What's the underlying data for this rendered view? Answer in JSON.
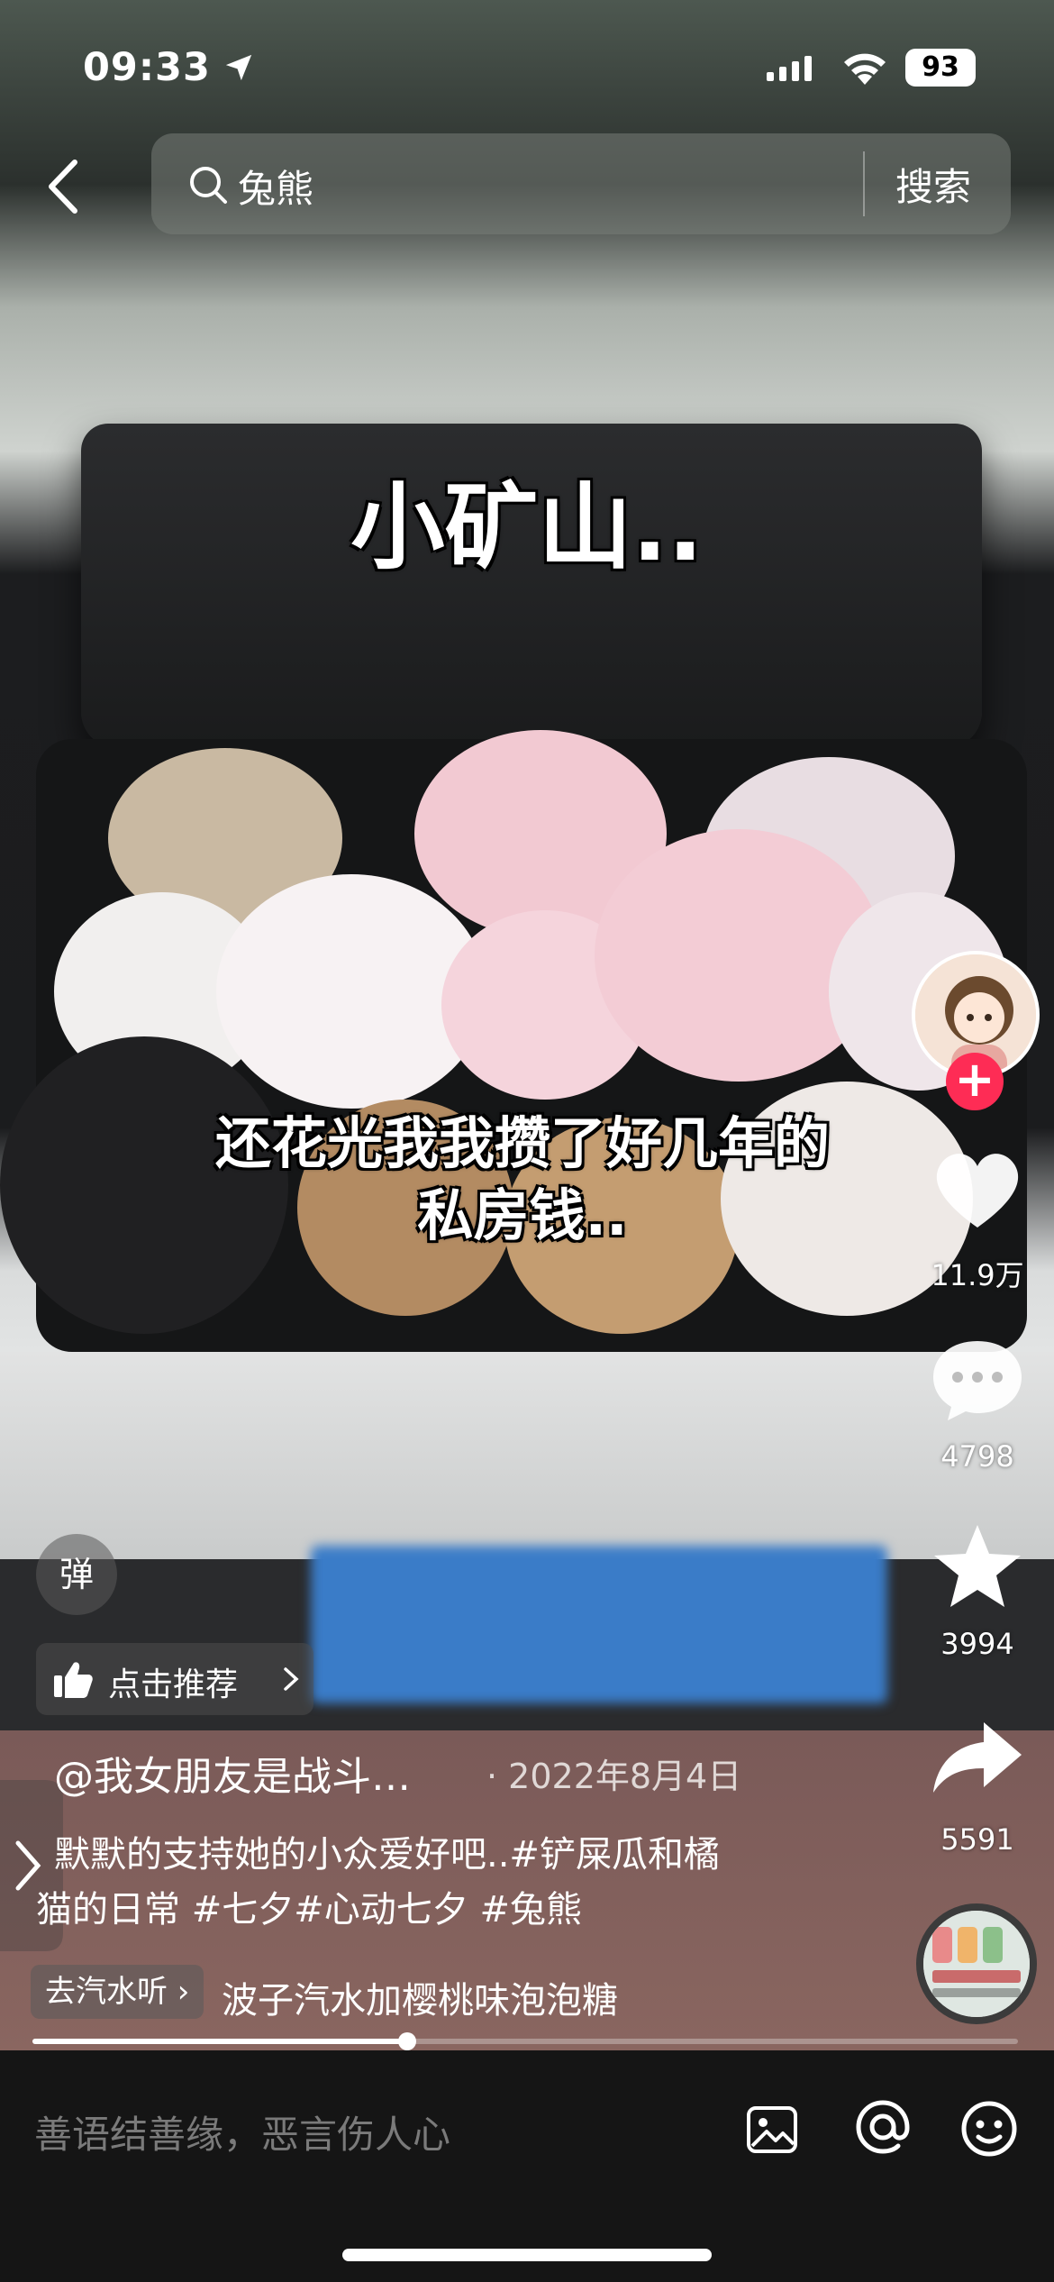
{
  "status_bar": {
    "time": "09:33",
    "battery": "93"
  },
  "search": {
    "query": "兔熊",
    "submit_label": "搜索"
  },
  "captions": {
    "top": "小矿山..",
    "middle_line_1": "还花光我我攒了好几年的",
    "middle_line_2": "私房钱.."
  },
  "actions": {
    "likes": "11.9万",
    "comments": "4798",
    "favorites": "3994",
    "shares": "5591"
  },
  "overlay": {
    "danmaku_label": "弹",
    "recommend_label": "点击推荐"
  },
  "video": {
    "title": "@我女朋友是战斗…",
    "date": "· 2022年8月4日",
    "description_line_1": "默默的支持她的小众爱好吧..#铲屎瓜和橘",
    "description_line_2": "猫的日常 #七夕#心动七夕 #兔熊",
    "progress": 0.38
  },
  "music": {
    "link_label": "去汽水听 ›",
    "title": "波子汽水加樱桃味泡泡糖"
  },
  "comment_bar": {
    "placeholder": "善语结善缘，恶言伤人心"
  }
}
